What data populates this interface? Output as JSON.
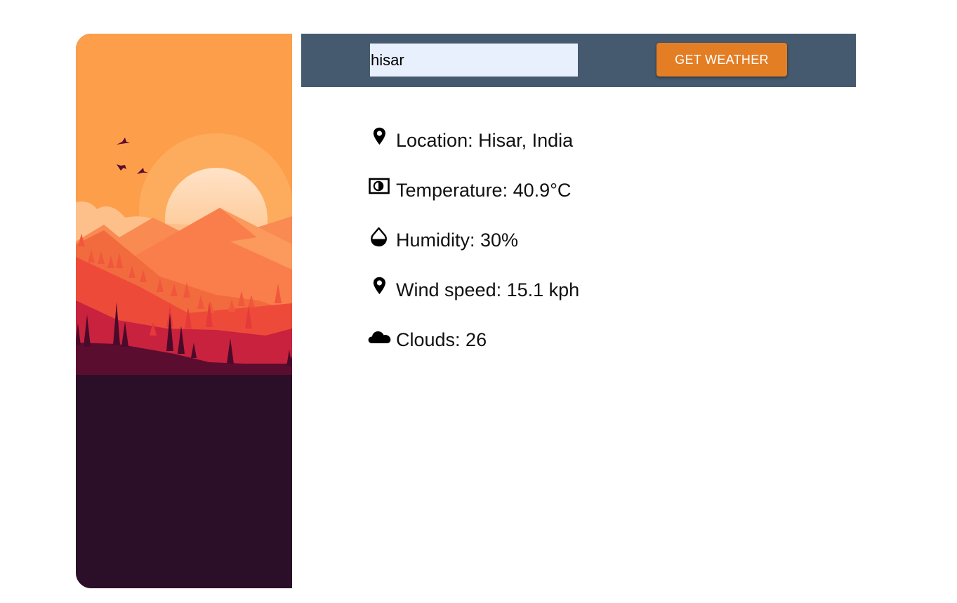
{
  "search": {
    "value": "hisar",
    "button_label": "GET WEATHER"
  },
  "weather": {
    "location": "Location: Hisar, India",
    "temperature": "Temperature: 40.9°C",
    "humidity": "Humidity: 30%",
    "wind": "Wind speed: 15.1 kph",
    "clouds": "Clouds: 26"
  },
  "icons": {
    "location": "map-pin-icon",
    "temperature": "thermometer-icon",
    "humidity": "water-drop-icon",
    "wind": "map-pin-icon",
    "clouds": "cloud-icon"
  },
  "colors": {
    "header_bg": "#455a6f",
    "button_bg": "#e47e24",
    "input_bg": "#e8f0fe",
    "sky": "#fd9e4a"
  }
}
